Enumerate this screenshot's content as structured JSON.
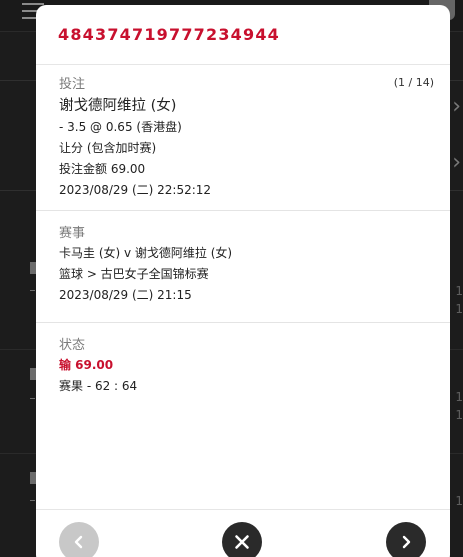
{
  "ticket": {
    "id": "484374719777234944",
    "counter": "(1 / 14)"
  },
  "bet": {
    "label": "投注",
    "team": "谢戈德阿维拉 (女)",
    "odds_line": "- 3.5 @ 0.65 (香港盘)",
    "market": "让分 (包含加时赛)",
    "stake": "投注金额 69.00",
    "placed_time": "2023/08/29 (二) 22:52:12"
  },
  "event": {
    "label": "赛事",
    "matchup": "卡马圭 (女) v 谢戈德阿维拉 (女)",
    "competition": "篮球 > 古巴女子全国锦标赛",
    "start_time": "2023/08/29 (二) 21:15"
  },
  "status": {
    "label": "状态",
    "result": "输 69.00",
    "score": "赛果 - 62 : 64"
  },
  "footer": {
    "prev_icon": "chevron-left-icon",
    "close_icon": "close-icon",
    "next_icon": "chevron-right-icon"
  },
  "colors": {
    "accent": "#c8102e",
    "dark_button": "#2a2a2a",
    "disabled_button": "#c8c8c8"
  }
}
